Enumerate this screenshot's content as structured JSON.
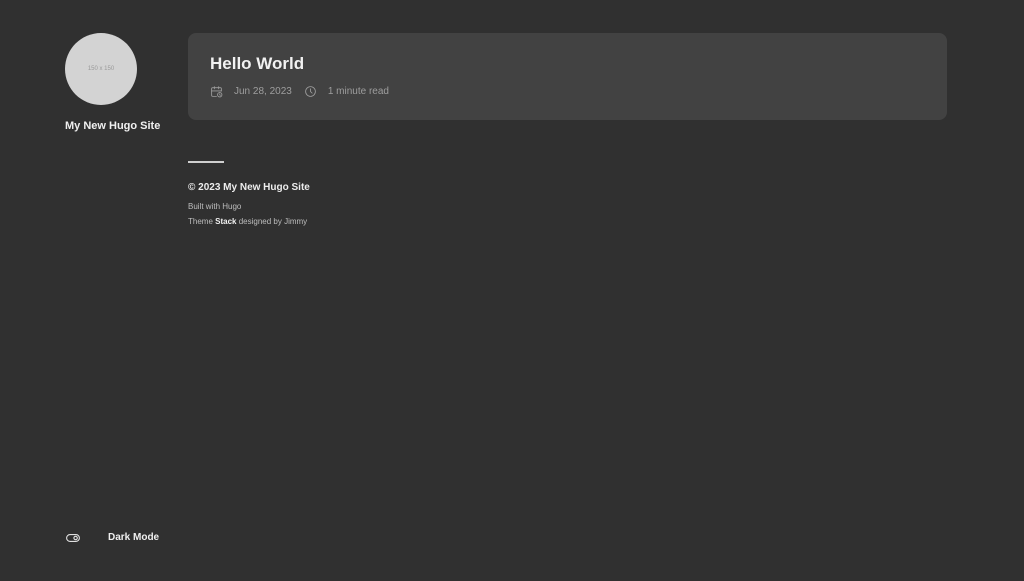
{
  "sidebar": {
    "avatar_text": "150 x 150",
    "site_name": "My New Hugo Site"
  },
  "article": {
    "title": "Hello World",
    "date": "Jun 28, 2023",
    "reading_time": "1 minute read",
    "date_icon": "calendar-icon",
    "time_icon": "clock-icon"
  },
  "footer": {
    "copyright": "© 2023 My New Hugo Site",
    "built_with": "Built with Hugo",
    "theme_prefix": "Theme ",
    "theme_name": "Stack",
    "theme_suffix": " designed by Jimmy"
  },
  "dark_mode": {
    "label": "Dark Mode",
    "icon": "toggle-icon"
  },
  "colors": {
    "background": "#303030",
    "card": "#424242",
    "text": "#e6e6e6",
    "muted": "#9e9e9e"
  }
}
